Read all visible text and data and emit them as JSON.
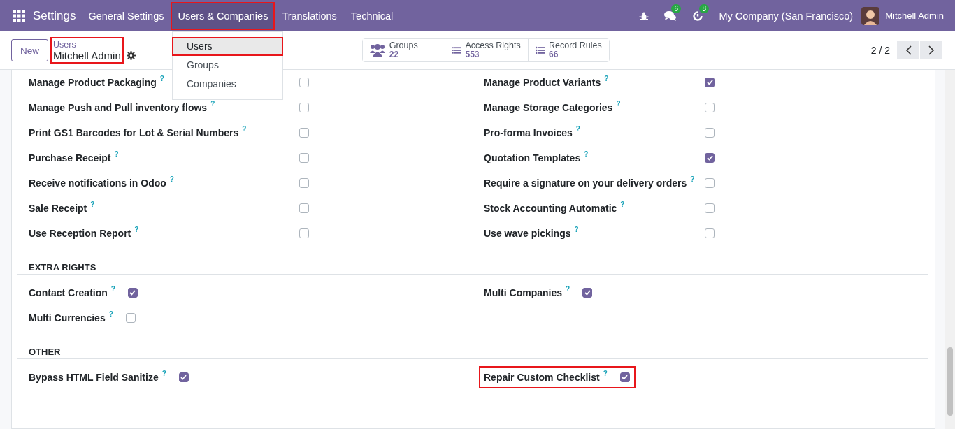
{
  "navbar": {
    "app_title": "Settings",
    "menus": [
      {
        "label": "General Settings",
        "selected": false,
        "highlighted": false
      },
      {
        "label": "Users & Companies",
        "selected": true,
        "highlighted": true
      },
      {
        "label": "Translations",
        "selected": false,
        "highlighted": false
      },
      {
        "label": "Technical",
        "selected": false,
        "highlighted": false
      }
    ],
    "systray": [
      {
        "kind": "bug"
      },
      {
        "kind": "chat",
        "badge": "6"
      },
      {
        "kind": "activity",
        "badge": "8"
      }
    ],
    "company": "My Company (San Francisco)",
    "user": "Mitchell Admin"
  },
  "dropdown": {
    "items": [
      {
        "label": "Users",
        "selected": true,
        "highlighted": true
      },
      {
        "label": "Groups",
        "selected": false,
        "highlighted": false
      },
      {
        "label": "Companies",
        "selected": false,
        "highlighted": false
      }
    ]
  },
  "control_panel": {
    "new_button": "New",
    "breadcrumb": {
      "parent": "Users",
      "current": "Mitchell Admin",
      "highlighted": true
    },
    "smart_buttons": [
      {
        "kind": "groups",
        "label": "Groups",
        "count": "22"
      },
      {
        "kind": "list",
        "label": "Access Rights",
        "count": "553"
      },
      {
        "kind": "bullets",
        "label": "Record Rules",
        "count": "66"
      }
    ],
    "pager": "2 / 2"
  },
  "sections": [
    {
      "kind": "wide",
      "fields": [
        {
          "label": "Manage Product Packaging",
          "help": "?",
          "checked": false,
          "highlighted": false
        },
        {
          "label": "Manage Product Variants",
          "help": "?",
          "checked": true,
          "highlighted": false
        },
        {
          "label": "Manage Push and Pull inventory flows",
          "help": "?",
          "checked": false,
          "highlighted": false
        },
        {
          "label": "Manage Storage Categories",
          "help": "?",
          "checked": false,
          "highlighted": false
        },
        {
          "label": "Print GS1 Barcodes for Lot & Serial Numbers",
          "help": "?",
          "checked": false,
          "highlighted": false
        },
        {
          "label": "Pro-forma Invoices",
          "help": "?",
          "checked": false,
          "highlighted": false
        },
        {
          "label": "Purchase Receipt",
          "help": "?",
          "checked": false,
          "highlighted": false
        },
        {
          "label": "Quotation Templates",
          "help": "?",
          "checked": true,
          "highlighted": false
        },
        {
          "label": "Receive notifications in Odoo",
          "help": "?",
          "checked": false,
          "highlighted": false
        },
        {
          "label": "Require a signature on your delivery orders",
          "help": "?",
          "checked": false,
          "highlighted": false
        },
        {
          "label": "Sale Receipt",
          "help": "?",
          "checked": false,
          "highlighted": false
        },
        {
          "label": "Stock Accounting Automatic",
          "help": "?",
          "checked": false,
          "highlighted": false
        },
        {
          "label": "Use Reception Report",
          "help": "?",
          "checked": false,
          "highlighted": false
        },
        {
          "label": "Use wave pickings",
          "help": "?",
          "checked": false,
          "highlighted": false
        }
      ]
    },
    {
      "title": "EXTRA RIGHTS",
      "kind": "inline",
      "fields": [
        {
          "label": "Contact Creation",
          "help": "?",
          "checked": true,
          "highlighted": false
        },
        {
          "label": "Multi Companies",
          "help": "?",
          "checked": true,
          "highlighted": false
        },
        {
          "label": "Multi Currencies",
          "help": "?",
          "checked": false,
          "highlighted": false
        }
      ]
    },
    {
      "title": "OTHER",
      "kind": "inline",
      "fields": [
        {
          "label": "Bypass HTML Field Sanitize",
          "help": "?",
          "checked": true,
          "highlighted": false
        },
        {
          "label": "Repair Custom Checklist",
          "help": "?",
          "checked": true,
          "highlighted": true
        }
      ]
    }
  ]
}
